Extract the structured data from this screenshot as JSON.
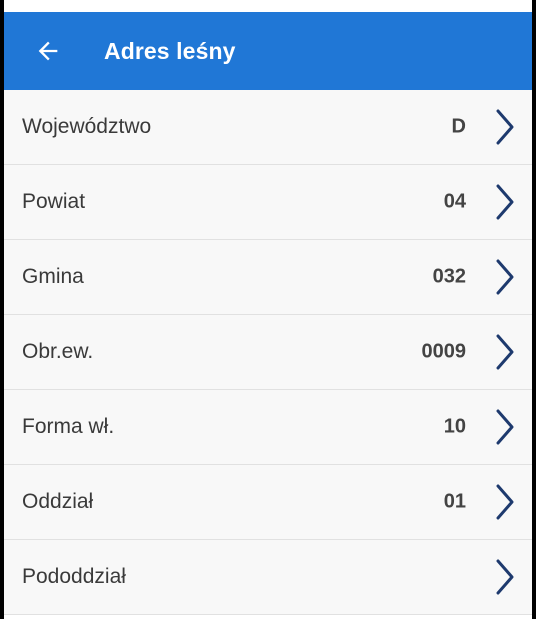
{
  "appbar": {
    "title": "Adres leśny",
    "back_icon": "arrow-left-icon",
    "background": "#2077d6"
  },
  "rows": [
    {
      "label": "Województwo",
      "value": "D",
      "icon": "chevron-right-icon"
    },
    {
      "label": "Powiat",
      "value": "04",
      "icon": "chevron-right-icon"
    },
    {
      "label": "Gmina",
      "value": "032",
      "icon": "chevron-right-icon"
    },
    {
      "label": "Obr.ew.",
      "value": "0009",
      "icon": "chevron-right-icon"
    },
    {
      "label": "Forma wł.",
      "value": "10",
      "icon": "chevron-right-icon"
    },
    {
      "label": "Oddział",
      "value": "01",
      "icon": "chevron-right-icon"
    },
    {
      "label": "Pododdział",
      "value": "",
      "icon": "chevron-right-icon"
    }
  ],
  "colors": {
    "accent": "#2077d6",
    "chevron": "#1e3a6e"
  }
}
